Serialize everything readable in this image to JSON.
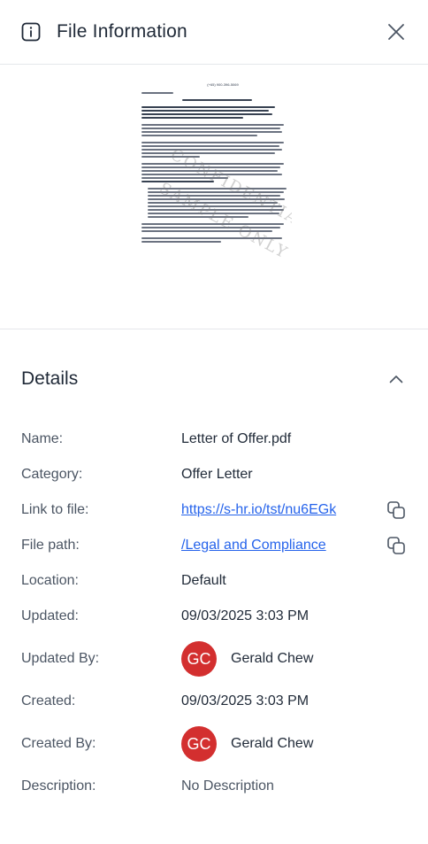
{
  "header": {
    "title": "File Information",
    "info_icon": "info-icon",
    "close_icon": "close-icon"
  },
  "preview": {
    "phone": "(+65) 900-396-5069",
    "watermark_1": "CONFIDENTIAL",
    "watermark_2": "SAMPLE ONLY"
  },
  "details": {
    "title": "Details",
    "rows": {
      "name": {
        "label": "Name:",
        "value": "Letter of Offer.pdf"
      },
      "category": {
        "label": "Category:",
        "value": "Offer Letter"
      },
      "link": {
        "label": "Link to file:",
        "value": "https://s-hr.io/tst/nu6EGk"
      },
      "path": {
        "label": "File path:",
        "value": "/Legal and Compliance"
      },
      "location": {
        "label": "Location:",
        "value": "Default"
      },
      "updated": {
        "label": "Updated:",
        "value": "09/03/2025 3:03 PM"
      },
      "updated_by": {
        "label": "Updated By:",
        "initials": "GC",
        "name": "Gerald Chew"
      },
      "created": {
        "label": "Created:",
        "value": "09/03/2025 3:03 PM"
      },
      "created_by": {
        "label": "Created By:",
        "initials": "GC",
        "name": "Gerald Chew"
      },
      "description": {
        "label": "Description:",
        "value": "No Description"
      }
    }
  },
  "colors": {
    "avatar_bg": "#d32f2f",
    "link": "#2563eb",
    "label": "#4b5563"
  }
}
